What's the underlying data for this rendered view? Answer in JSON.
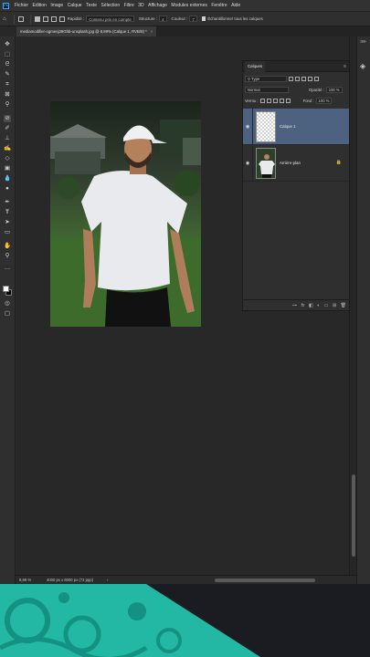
{
  "menu": {
    "app_icon": "Ps",
    "items": [
      "Fichier",
      "Edition",
      "Image",
      "Calque",
      "Texte",
      "Sélection",
      "Filtre",
      "3D",
      "Affichage",
      "Modules externes",
      "Fenêtre",
      "Aide"
    ]
  },
  "options": {
    "sample_label": "Rapidité :",
    "sample_value": "Contenu pris en compte",
    "structure_label": "Structure :",
    "structure_value": "4",
    "color_label": "Couleur :",
    "color_value": "7",
    "sample_all_label": "Échantillonner tous les calques"
  },
  "document": {
    "tab_title": "mediamodifier-ogmenj39Ghb-unsplash.jpg @ 8,99% (Calque 1, RVB/8) *",
    "close": "×"
  },
  "layers_panel": {
    "tab": "Calques",
    "filter_label": "Type",
    "blend_mode": "Normal",
    "opacity_label": "Opacité :",
    "opacity_value": "100 %",
    "lock_label": "Verrou :",
    "fill_label": "Fond :",
    "fill_value": "100 %",
    "layers": [
      {
        "name": "Calque 1",
        "selected": true
      },
      {
        "name": "Arrière-plan",
        "selected": false
      }
    ]
  },
  "status": {
    "zoom": "8,99 %",
    "info": "4000 px x 6000 px (72 ppp)"
  },
  "colors": {
    "selection": "#4d6281",
    "accent": "#31a8ff",
    "teal": "#22b8a4"
  },
  "icons": {
    "visibility": "eye-icon",
    "lock": "lock-icon",
    "move": "move-tool-icon",
    "hand": "hand-tool-icon",
    "zoom": "zoom-tool-icon"
  }
}
